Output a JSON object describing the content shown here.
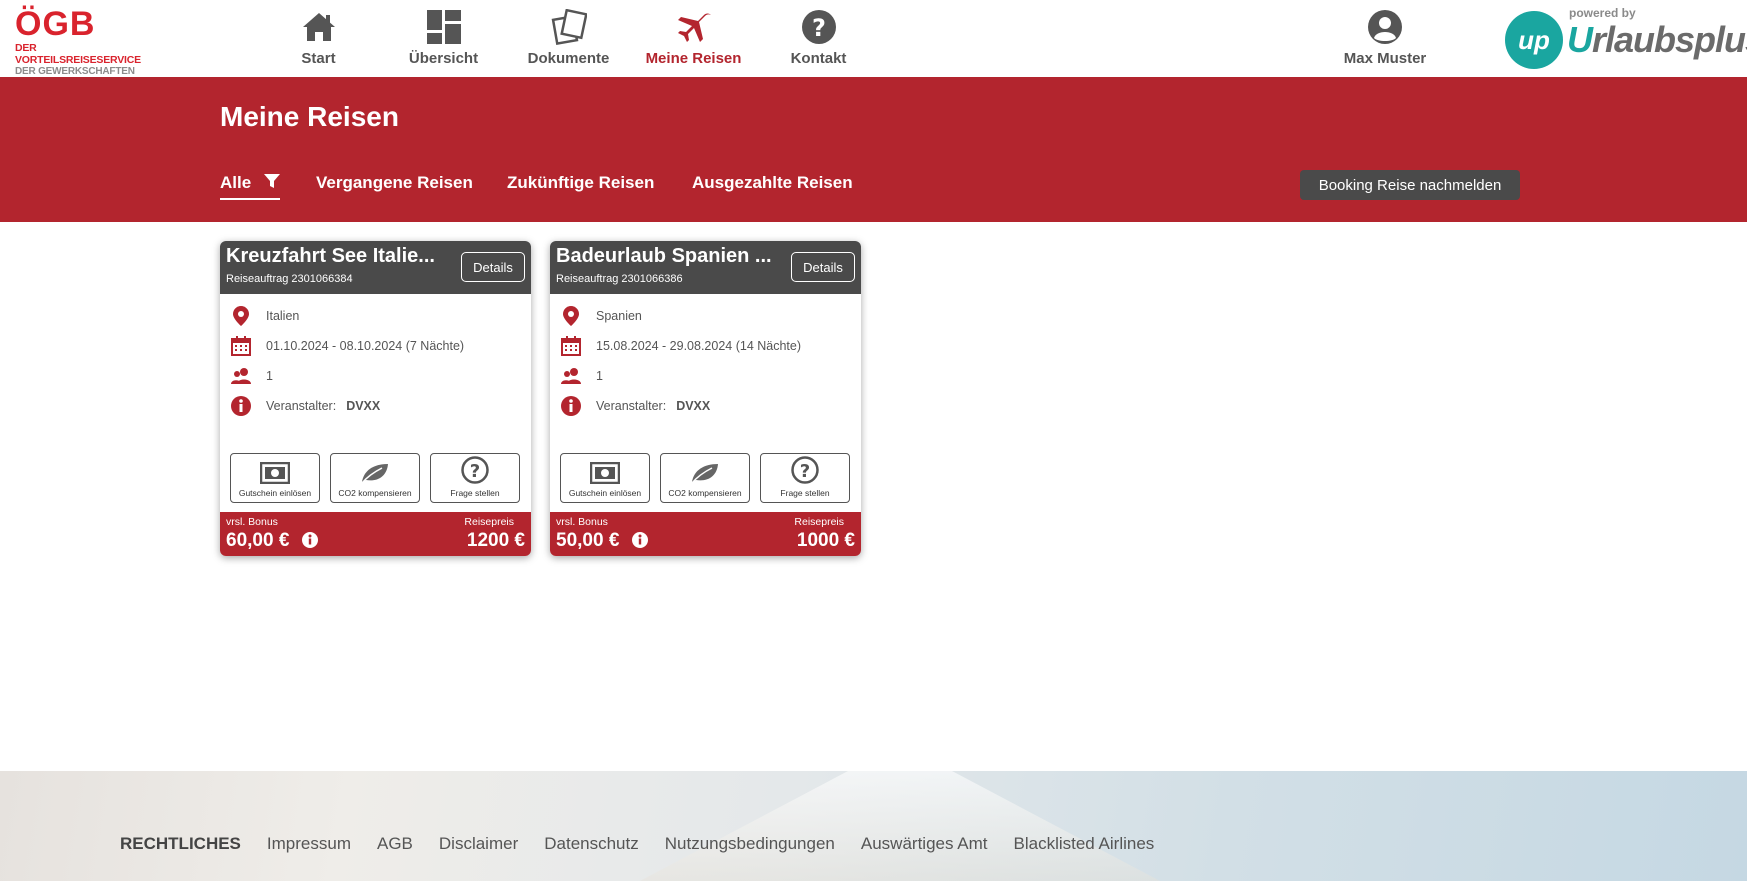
{
  "logo": {
    "brand": "ÖGB",
    "line1": "DER VORTEILSREISESERVICE",
    "line2": "DER GEWERKSCHAFTEN"
  },
  "nav": {
    "items": [
      {
        "label": "Start",
        "icon": "home-icon"
      },
      {
        "label": "Übersicht",
        "icon": "dashboard-icon"
      },
      {
        "label": "Dokumente",
        "icon": "documents-icon"
      },
      {
        "label": "Meine Reisen",
        "icon": "airplane-icon",
        "active": true
      },
      {
        "label": "Kontakt",
        "icon": "help-icon"
      }
    ]
  },
  "user": {
    "name": "Max Muster",
    "icon": "user-icon"
  },
  "powered": {
    "by": "powered by",
    "badge": "up",
    "brand_first": "U",
    "brand_rest": "rlaubsplus"
  },
  "page": {
    "title": "Meine Reisen",
    "filters": [
      "Alle",
      "Vergangene Reisen",
      "Zukünftige Reisen",
      "Ausgezahlte Reisen"
    ],
    "booking_button": "Booking Reise nachmelden"
  },
  "colors": {
    "accent": "#b3252e",
    "dark": "#4a4a4a",
    "teal": "#1aa6a0"
  },
  "trips": [
    {
      "title": "Kreuzfahrt See Italie...",
      "order": "Reiseauftrag 2301066384",
      "details": "Details",
      "country": "Italien",
      "dates": "01.10.2024 - 08.10.2024 (7 Nächte)",
      "persons": "1",
      "organizer_label": "Veranstalter:",
      "organizer": "DVXX",
      "actions": [
        "Gutschein einlösen",
        "CO2 kompensieren",
        "Frage stellen"
      ],
      "bonus_label": "vrsl. Bonus",
      "bonus": "60,00 €",
      "price_label": "Reisepreis",
      "price": "1200 €"
    },
    {
      "title": "Badeurlaub Spanien ...",
      "order": "Reiseauftrag 2301066386",
      "details": "Details",
      "country": "Spanien",
      "dates": "15.08.2024 - 29.08.2024 (14 Nächte)",
      "persons": "1",
      "organizer_label": "Veranstalter:",
      "organizer": "DVXX",
      "actions": [
        "Gutschein einlösen",
        "CO2 kompensieren",
        "Frage stellen"
      ],
      "bonus_label": "vrsl. Bonus",
      "bonus": "50,00 €",
      "price_label": "Reisepreis",
      "price": "1000 €"
    }
  ],
  "footer": {
    "heading": "RECHTLICHES",
    "links": [
      "Impressum",
      "AGB",
      "Disclaimer",
      "Datenschutz",
      "Nutzungsbedingungen",
      "Auswärtiges Amt",
      "Blacklisted Airlines"
    ]
  }
}
